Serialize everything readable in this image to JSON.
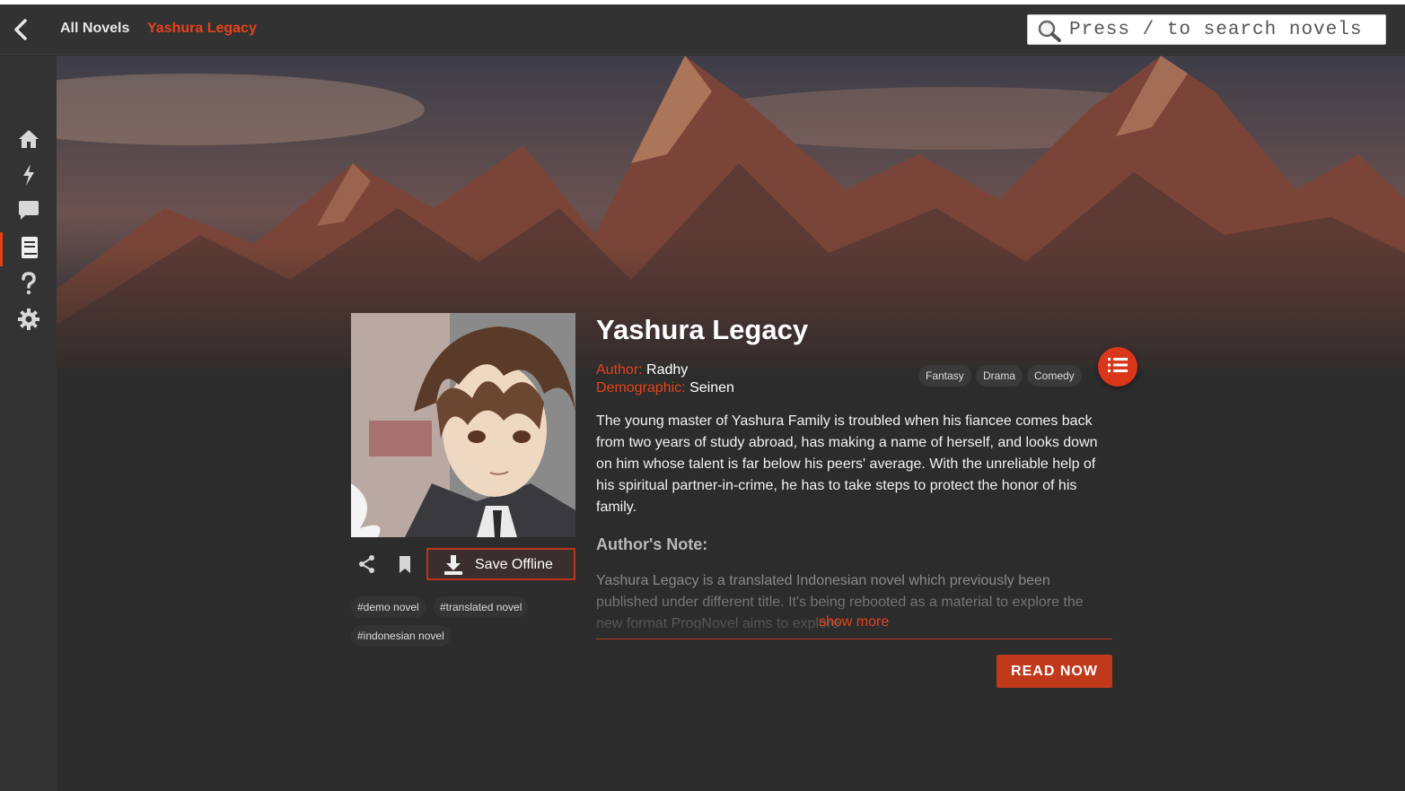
{
  "topbar": {
    "breadcrumb": [
      "All Novels",
      "Yashura Legacy"
    ],
    "search_placeholder": "Press / to search novels"
  },
  "sidebar": {
    "items": [
      {
        "icon": "home-icon",
        "active": false
      },
      {
        "icon": "lightning-icon",
        "active": false
      },
      {
        "icon": "chat-icon",
        "active": false
      },
      {
        "icon": "book-icon",
        "active": true
      },
      {
        "icon": "help-icon",
        "active": false
      },
      {
        "icon": "gear-icon",
        "active": false
      }
    ]
  },
  "novel": {
    "title": "Yashura Legacy",
    "author_label": "Author:",
    "author": "Radhy",
    "demographic_label": "Demographic:",
    "demographic": "Seinen",
    "genres": [
      "Fantasy",
      "Drama",
      "Comedy"
    ],
    "synopsis": "The young master of Yashura Family is troubled when his fiancee comes back from two years of study abroad, has making a name of herself, and looks down on him whose talent is far below his peers' average. With the unreliable help of his spiritual partner-in-crime, he has to take steps to protect the honor of his family.",
    "note_heading": "Author's Note:",
    "note_text": "Yashura Legacy is a translated Indonesian novel which previously been published under different title. It's being rebooted as a material to explore the new format ProgNovel aims to explore",
    "show_more": "show more",
    "tags": [
      "#demo novel",
      "#translated novel",
      "#indonesian novel"
    ]
  },
  "actions": {
    "save_offline": "Save Offline",
    "read_now": "READ NOW"
  },
  "colors": {
    "accent": "#e5421c",
    "background": "#2c2c2c",
    "sidebar": "#333333"
  }
}
